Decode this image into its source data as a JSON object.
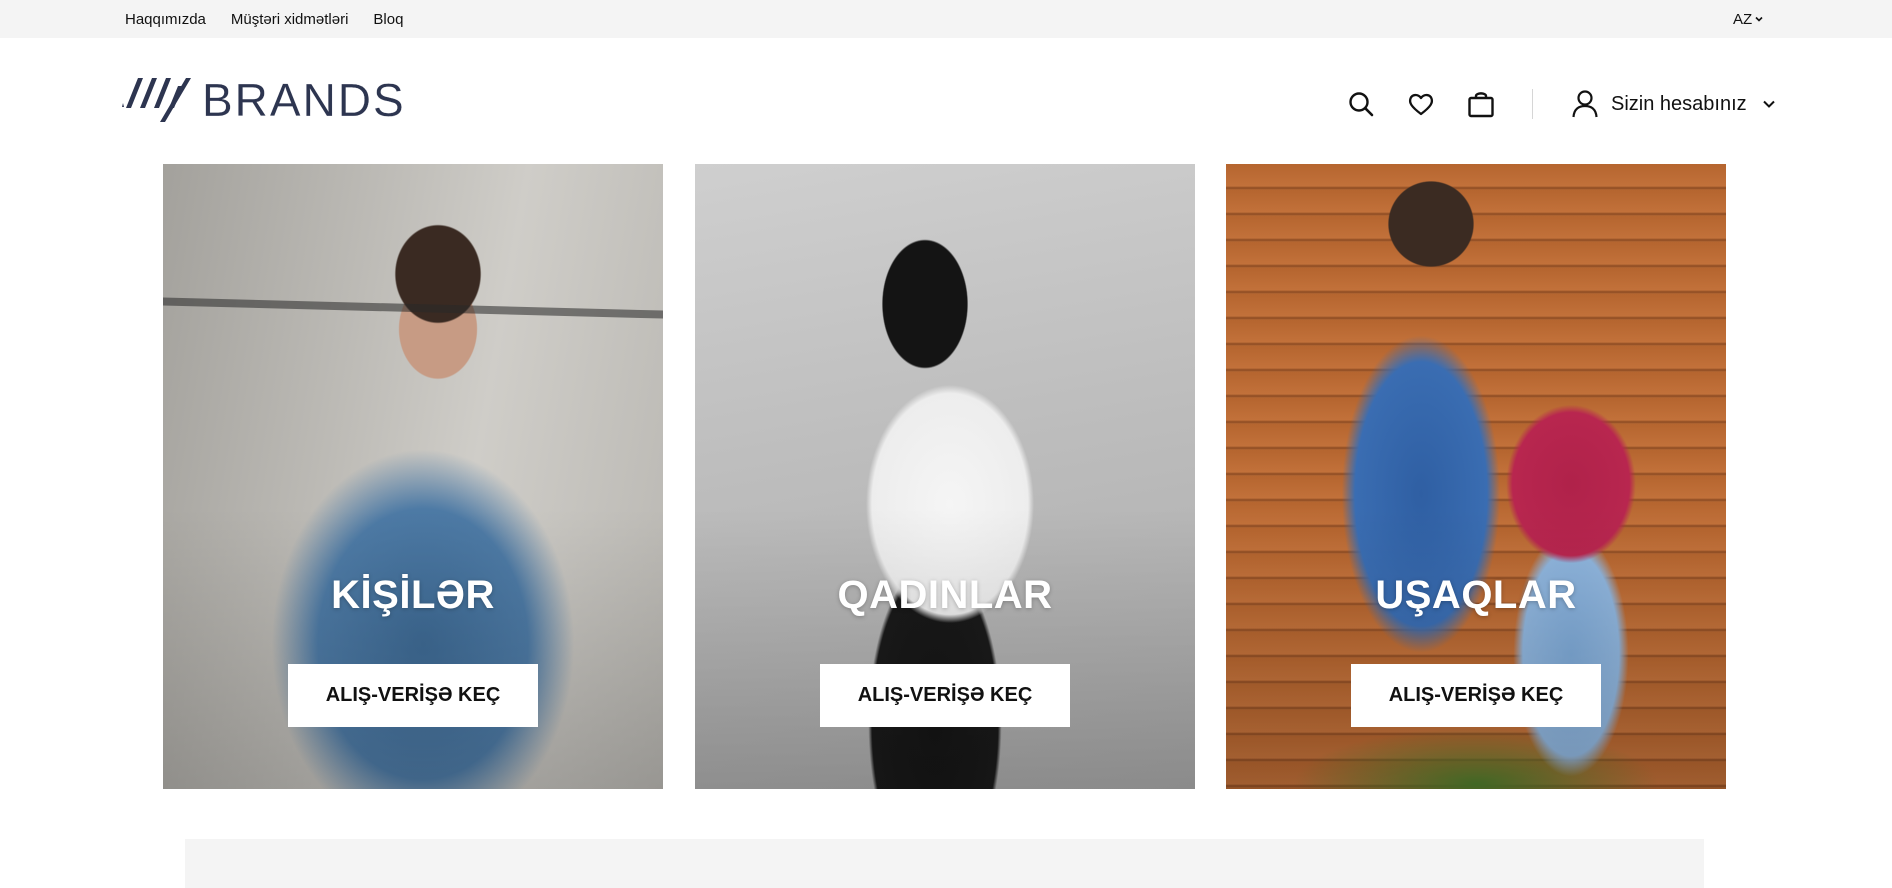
{
  "topbar": {
    "links": [
      "Haqqımızda",
      "Müştəri xidmətləri",
      "Bloq"
    ],
    "language": "AZ"
  },
  "header": {
    "logo_text": "BRANDS",
    "icons": [
      "search-icon",
      "heart-icon",
      "shopping-bag-icon",
      "user-icon"
    ],
    "account_label": "Sizin hesabınız"
  },
  "categories": [
    {
      "title": "KİŞİLƏR",
      "button": "ALIŞ-VERİŞƏ KEÇ"
    },
    {
      "title": "QADINLAR",
      "button": "ALIŞ-VERİŞƏ KEÇ"
    },
    {
      "title": "UŞAQLAR",
      "button": "ALIŞ-VERİŞƏ KEÇ"
    }
  ],
  "colors": {
    "topbar_bg": "#f4f4f4",
    "logo": "#2d3550",
    "text": "#111111",
    "button_bg": "#ffffff"
  }
}
